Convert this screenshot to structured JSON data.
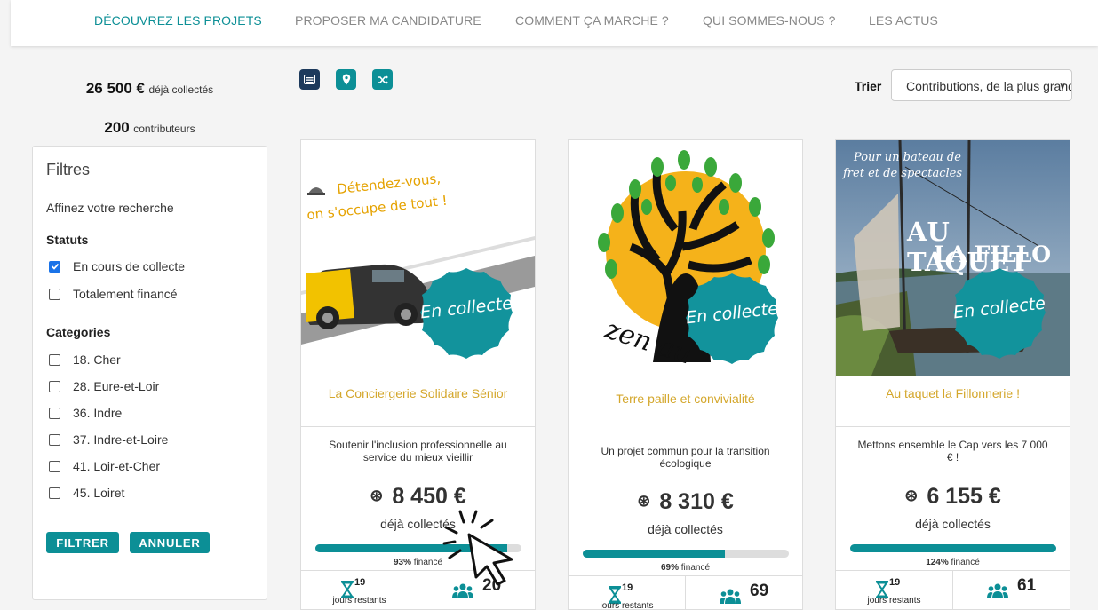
{
  "nav": {
    "items": [
      "DÉCOUVREZ LES PROJETS",
      "PROPOSER MA CANDIDATURE",
      "COMMENT ÇA MARCHE ?",
      "QUI SOMMES-NOUS ?",
      "LES ACTUS"
    ]
  },
  "stats": {
    "collected_value": "26 500 €",
    "collected_label": "déjà collectés",
    "contributors_value": "200",
    "contributors_label": "contributeurs"
  },
  "filters": {
    "title": "Filtres",
    "subtitle": "Affinez votre recherche",
    "status_heading": "Statuts",
    "status_options": [
      {
        "label": "En cours de collecte",
        "checked": true
      },
      {
        "label": "Totalement financé",
        "checked": false
      }
    ],
    "category_heading": "Categories",
    "categories": [
      "18. Cher",
      "28. Eure-et-Loir",
      "36. Indre",
      "37. Indre-et-Loire",
      "41. Loir-et-Cher",
      "45. Loiret"
    ],
    "filter_button": "FILTRER",
    "cancel_button": "ANNULER"
  },
  "sort": {
    "label": "Trier",
    "selected": "Contributions, de la plus grande à la plus petite"
  },
  "badge_text": "En collecte",
  "cards": [
    {
      "image_text_1": "Détendez-vous,",
      "image_text_2": "on s'occupe de tout !",
      "title": "La Conciergerie Solidaire Sénior",
      "description": "Soutenir l'inclusion professionnelle au service du mieux vieillir",
      "amount": "8 450 €",
      "collected_label": "déjà collectés",
      "percent_label": "93%",
      "financed_label": "financé",
      "progress": 0.93,
      "days": "19",
      "days_label": "jours restants",
      "contributors": "20"
    },
    {
      "image_text_1": "zen au",
      "title": "Terre paille et convivialité",
      "description": "Un projet commun pour la transition écologique",
      "amount": "8 310 €",
      "collected_label": "déjà collectés",
      "percent_label": "69%",
      "financed_label": "financé",
      "progress": 0.69,
      "days": "19",
      "days_label": "jours restants",
      "contributors": "69"
    },
    {
      "image_text_1": "Pour un bateau de",
      "image_text_2": "fret et de spectacles",
      "image_text_3": "AU TAQUET",
      "image_text_4": "LA FILLO",
      "title": "Au taquet la Fillonnerie !",
      "description": "Mettons ensemble le Cap vers les 7 000 € !",
      "amount": "6 155 €",
      "collected_label": "déjà collectés",
      "percent_label": "124%",
      "financed_label": "financé",
      "progress": 1.0,
      "days": "19",
      "days_label": "jours restants",
      "contributors": "61"
    }
  ],
  "colors": {
    "accent": "#0c8f96",
    "title_gold": "#d4a72c",
    "checkbox_blue": "#1a73e8"
  }
}
